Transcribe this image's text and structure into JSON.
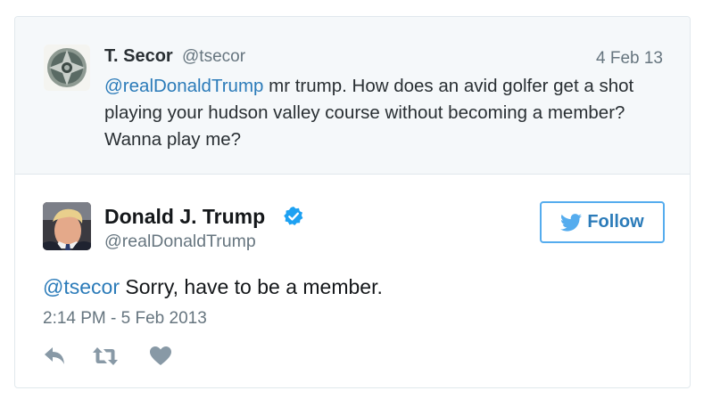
{
  "parent_tweet": {
    "display_name": "T. Secor",
    "handle": "@tsecor",
    "date": "4 Feb 13",
    "mention": "@realDonaldTrump",
    "text_line1": " mr trump. How does an avid golfer get a shot",
    "text_line2": "playing your hudson valley course without becoming a member?",
    "text_line3": "Wanna play me?"
  },
  "main_tweet": {
    "display_name": "Donald J. Trump",
    "handle": "@realDonaldTrump",
    "mention": "@tsecor",
    "text": " Sorry, have to be a member.",
    "timestamp": "2:14 PM - 5 Feb 2013",
    "follow_label": "Follow"
  },
  "actions": {
    "icons": [
      "reply-icon",
      "retweet-icon",
      "like-icon"
    ]
  },
  "colors": {
    "link": "#2b7bb9",
    "verified": "#1da1f2",
    "muted": "#66757f",
    "parent_bg": "#f5f8fa",
    "icon": "#8899a6"
  }
}
